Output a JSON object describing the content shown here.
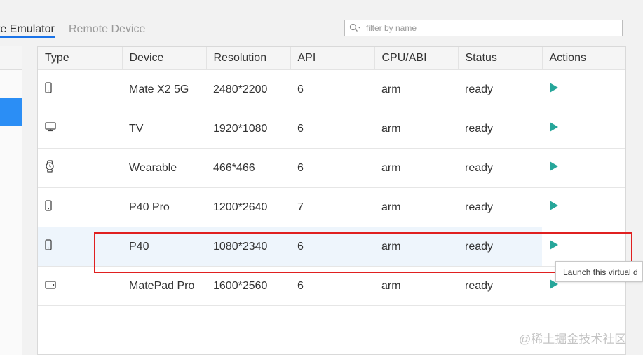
{
  "tabs": {
    "remote_emulator": "te Emulator",
    "remote_device": "Remote Device"
  },
  "search": {
    "placeholder": "filter by name",
    "value": ""
  },
  "table": {
    "columns": [
      "Type",
      "Device",
      "Resolution",
      "API",
      "CPU/ABI",
      "Status",
      "Actions"
    ],
    "rows": [
      {
        "type_icon": "phone-icon",
        "device": "Mate X2 5G",
        "resolution": "2480*2200",
        "api": "6",
        "cpu": "arm",
        "status": "ready"
      },
      {
        "type_icon": "tv-icon",
        "device": "TV",
        "resolution": "1920*1080",
        "api": "6",
        "cpu": "arm",
        "status": "ready"
      },
      {
        "type_icon": "watch-icon",
        "device": "Wearable",
        "resolution": "466*466",
        "api": "6",
        "cpu": "arm",
        "status": "ready"
      },
      {
        "type_icon": "phone-icon",
        "device": "P40 Pro",
        "resolution": "1200*2640",
        "api": "7",
        "cpu": "arm",
        "status": "ready"
      },
      {
        "type_icon": "phone-icon",
        "device": "P40",
        "resolution": "1080*2340",
        "api": "6",
        "cpu": "arm",
        "status": "ready"
      },
      {
        "type_icon": "tablet-icon",
        "device": "MatePad Pro",
        "resolution": "1600*2560",
        "api": "6",
        "cpu": "arm",
        "status": "ready"
      }
    ]
  },
  "tooltip": "Launch this virtual d",
  "watermark": "@稀土掘金技术社区",
  "colors": {
    "accent": "#2b8ef5",
    "play": "#26a69a",
    "highlight": "#e02020",
    "row_hover": "#eef5fc"
  }
}
